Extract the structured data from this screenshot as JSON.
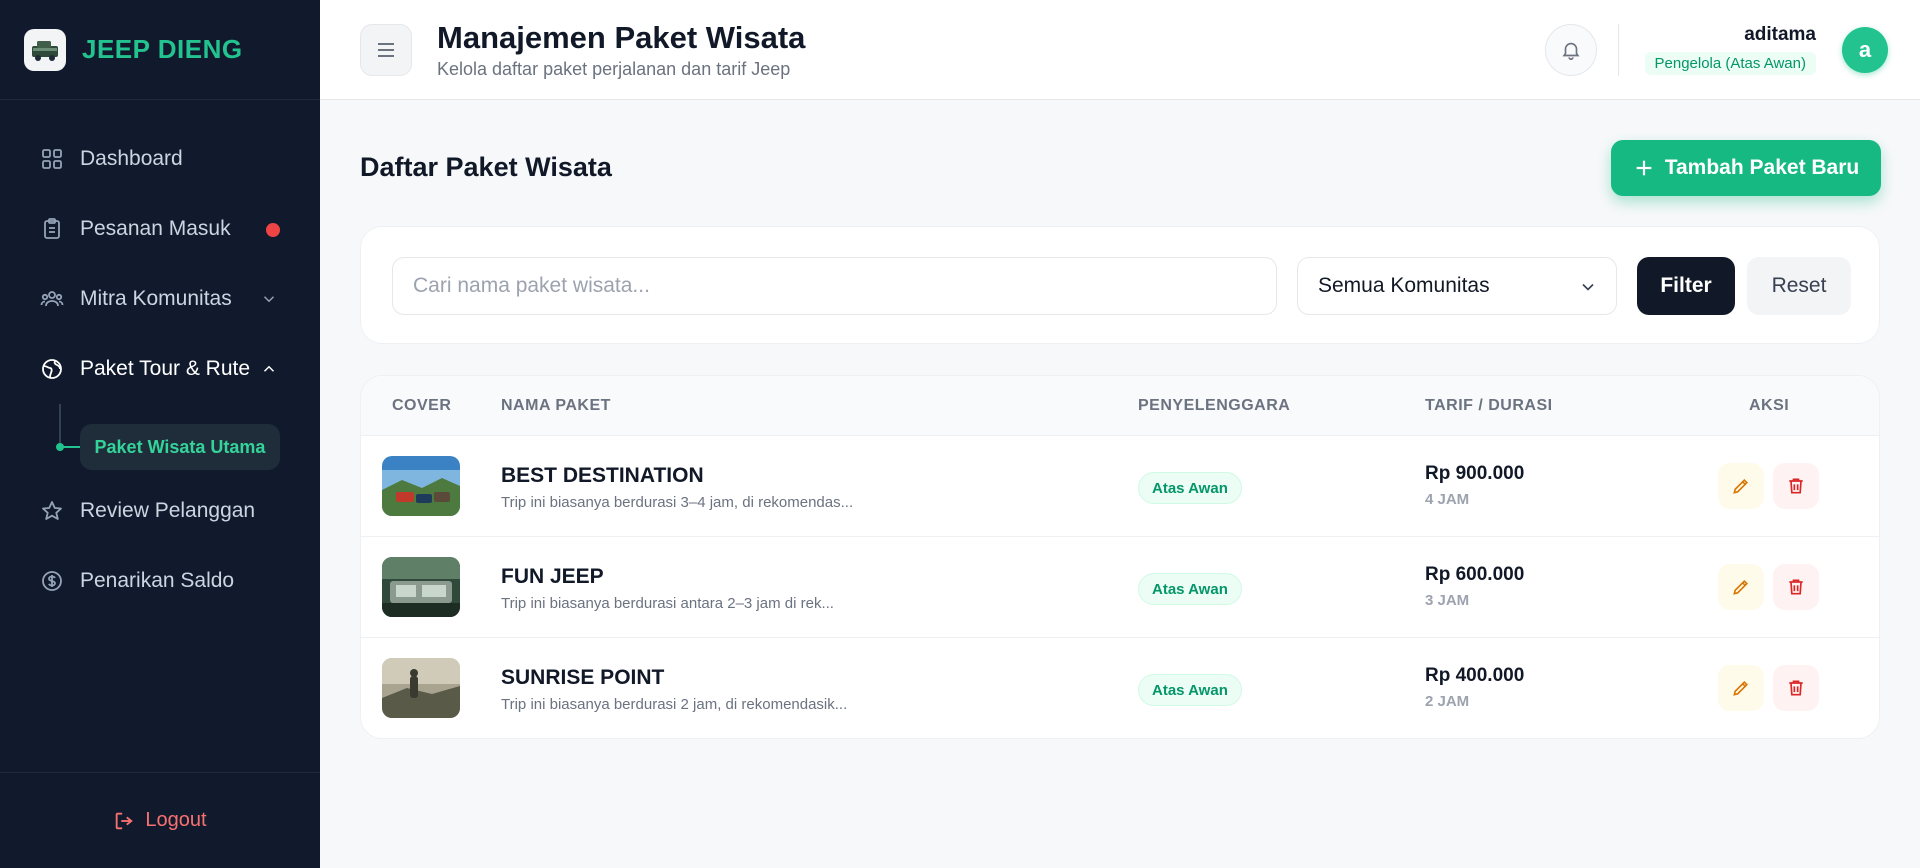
{
  "brand": {
    "name": "JEEP DIENG",
    "logo_text": "JEEP"
  },
  "sidebar": {
    "items": [
      {
        "label": "Dashboard",
        "icon": "grid-icon"
      },
      {
        "label": "Pesanan Masuk",
        "icon": "clipboard-icon",
        "has_notification": true
      },
      {
        "label": "Mitra Komunitas",
        "icon": "users-icon",
        "expandable": true,
        "expanded": false
      },
      {
        "label": "Paket Tour & Rute",
        "icon": "globe-icon",
        "expandable": true,
        "expanded": true
      },
      {
        "label": "Review Pelanggan",
        "icon": "star-icon"
      },
      {
        "label": "Penarikan Saldo",
        "icon": "dollar-icon"
      }
    ],
    "sub_items": [
      {
        "label": "Paket Wisata Utama",
        "active": true
      }
    ],
    "logout_label": "Logout"
  },
  "header": {
    "title": "Manajemen Paket Wisata",
    "subtitle": "Kelola daftar paket perjalanan dan tarif Jeep",
    "user_name": "aditama",
    "user_role": "Pengelola (Atas Awan)",
    "avatar_initial": "a"
  },
  "main": {
    "section_title": "Daftar Paket Wisata",
    "add_button_label": "Tambah Paket Baru",
    "search_placeholder": "Cari nama paket wisata...",
    "community_select_value": "Semua Komunitas",
    "filter_label": "Filter",
    "reset_label": "Reset"
  },
  "table": {
    "columns": [
      "COVER",
      "NAMA PAKET",
      "PENYELENGGARA",
      "TARIF / DURASI",
      "AKSI"
    ],
    "rows": [
      {
        "name": "BEST DESTINATION",
        "description": "Trip ini biasanya berdurasi 3–4 jam, di rekomendas...",
        "organizer": "Atas Awan",
        "price": "Rp 900.000",
        "duration": "4 JAM"
      },
      {
        "name": "FUN JEEP",
        "description": "Trip ini biasanya berdurasi antara 2–3 jam di rek...",
        "organizer": "Atas Awan",
        "price": "Rp 600.000",
        "duration": "3 JAM"
      },
      {
        "name": "SUNRISE POINT",
        "description": "Trip ini biasanya berdurasi 2 jam, di rekomendasik...",
        "organizer": "Atas Awan",
        "price": "Rp 400.000",
        "duration": "2 JAM"
      }
    ]
  },
  "colors": {
    "sidebar_bg": "#111a2c",
    "accent_green": "#16b981",
    "brand_green": "#22c38e",
    "notification_red": "#ef4444",
    "logout_red": "#f87171"
  }
}
